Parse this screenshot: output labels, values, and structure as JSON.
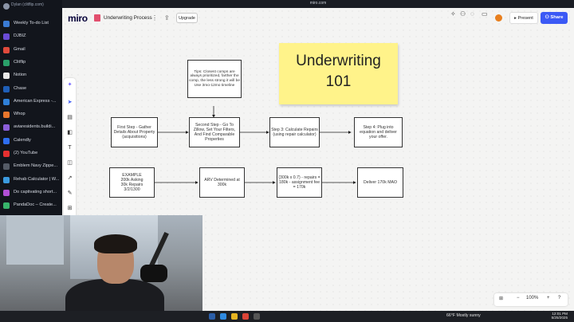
{
  "browser": {
    "url": "miro.com"
  },
  "sidebar": {
    "profile": "Dylan (clitflip.com)",
    "items": [
      {
        "label": "Weekly To-do List",
        "color": "#3a7bd5"
      },
      {
        "label": "DJBIZ",
        "color": "#6a4bd6"
      },
      {
        "label": "Gmail",
        "color": "#e04a3c"
      },
      {
        "label": "Clitflip",
        "color": "#2aa06a"
      },
      {
        "label": "Notion",
        "color": "#e8e8e8"
      },
      {
        "label": "Chase",
        "color": "#1f5fb8"
      },
      {
        "label": "American Express -...",
        "color": "#2f80d8"
      },
      {
        "label": "Whop",
        "color": "#e8762c"
      },
      {
        "label": "aviaresidents.buildi...",
        "color": "#8b5ed9"
      },
      {
        "label": "Calendly",
        "color": "#2e6ef2"
      },
      {
        "label": "(2) YouTube",
        "color": "#e63030"
      },
      {
        "label": "Emblem Navy Zippe...",
        "color": "#555b66"
      },
      {
        "label": "Rehab Calculator | W...",
        "color": "#3b9be0"
      },
      {
        "label": "Do captivating short...",
        "color": "#b24fd6"
      },
      {
        "label": "PandaDoc – Create...",
        "color": "#37b36b"
      }
    ]
  },
  "miro": {
    "logo": "miro",
    "board_title": "Underwriting Process",
    "upgrade": "Upgrade",
    "present": "Present",
    "share": "Share",
    "zoom": "100%"
  },
  "board": {
    "sticky": {
      "line1": "Underwriting",
      "line2": "101"
    },
    "tips": "Tips: Closest comps are always prioritized, farther the comp, the less strong it will be\nUse 3mo-12mo timeline",
    "step1": "First Step - Gather Details About Property (acquisitions)",
    "step2": "Second Step - Go To Zillow, Set Your Filters, And Find Comparable Properties",
    "step3": "Step 3: Calculate Repairs (using repair calculator)",
    "step4": "Step 4: Plug into equation and deliver your offer.",
    "example": "EXAMPLE\n200k Asking\n30k Repairs\n3/2/1300",
    "arv": "ARV Determined at 300k",
    "calc": "(300k x 0.7) - repairs = 180k - assignment fee = 170k",
    "deliver": "Deliver 170k MAO"
  },
  "taskbar": {
    "weather": "66°F  Mostly sunny",
    "time": "12:01 PM",
    "date": "5/25/2025"
  }
}
